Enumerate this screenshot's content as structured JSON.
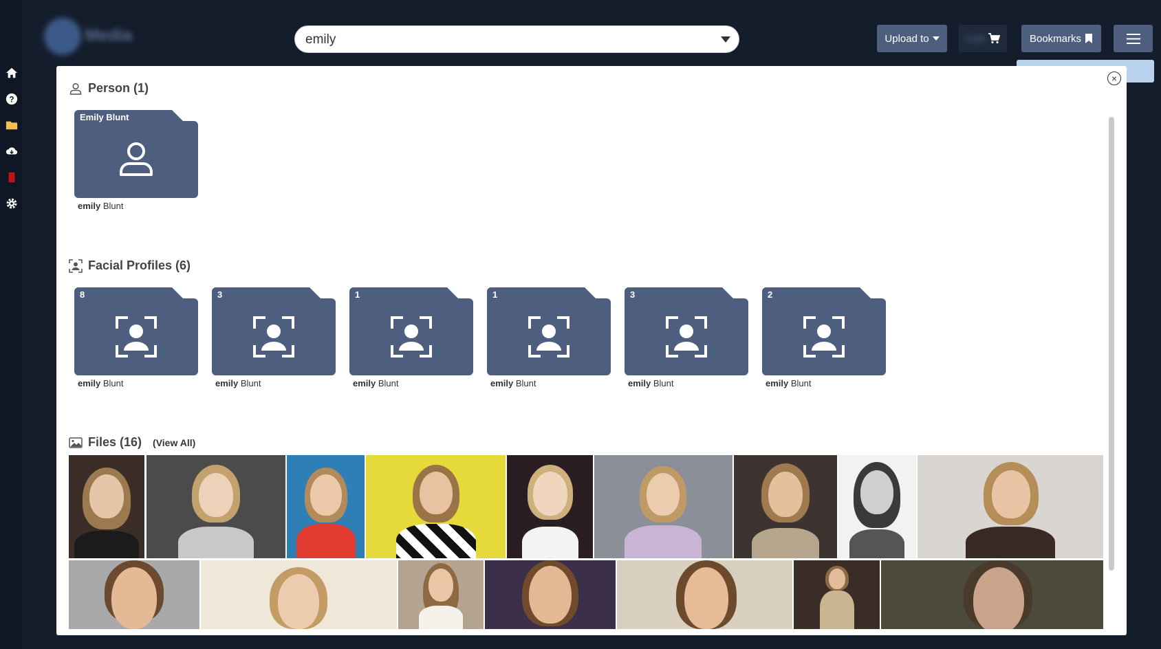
{
  "search": {
    "value": "emily"
  },
  "header": {
    "upload_label": "Upload to",
    "cart_label": "Cart",
    "bookmarks_label": "Bookmarks"
  },
  "modal": {
    "close_symbol": "×",
    "person_section": {
      "title": "Person (1)",
      "items": [
        {
          "tag": "Emily Blunt",
          "label_bold": "emily",
          "label_rest": " Blunt"
        }
      ]
    },
    "facial_section": {
      "title": "Facial Profiles (6)",
      "items": [
        {
          "count": "8",
          "label_bold": "emily",
          "label_rest": " Blunt"
        },
        {
          "count": "3",
          "label_bold": "emily",
          "label_rest": " Blunt"
        },
        {
          "count": "1",
          "label_bold": "emily",
          "label_rest": " Blunt"
        },
        {
          "count": "1",
          "label_bold": "emily",
          "label_rest": " Blunt"
        },
        {
          "count": "3",
          "label_bold": "emily",
          "label_rest": " Blunt"
        },
        {
          "count": "2",
          "label_bold": "emily",
          "label_rest": " Blunt"
        }
      ]
    },
    "files_section": {
      "title": "Files (16)",
      "view_all_label": "(View All)"
    }
  },
  "colors": {
    "folder": "#4d5e7e",
    "accent_button": "#4d5e7e",
    "page_bg": "#141d2b"
  }
}
